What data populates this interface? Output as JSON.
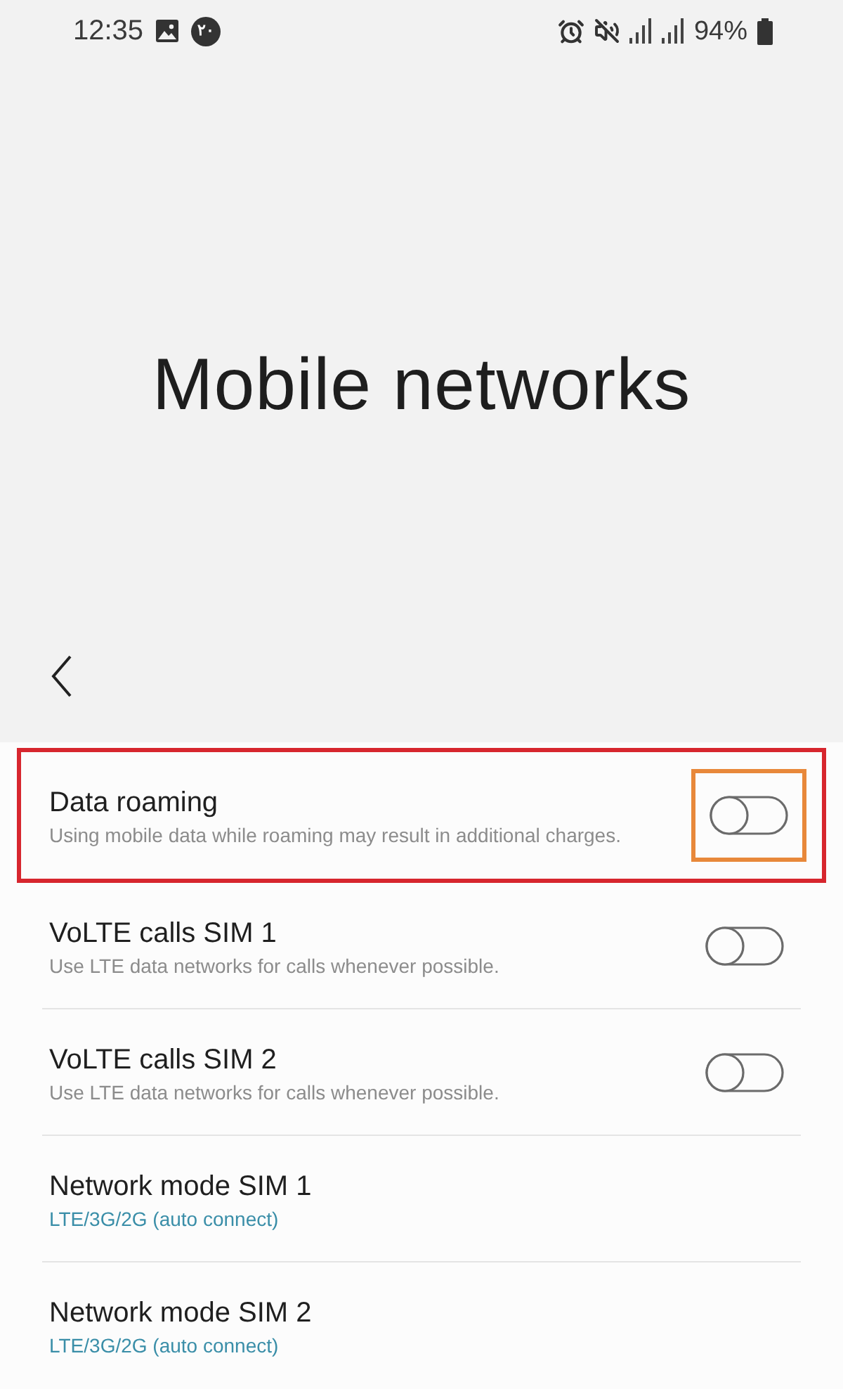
{
  "status_bar": {
    "time": "12:35",
    "notification_badge": "۲۰",
    "battery": "94%"
  },
  "header": {
    "title": "Mobile networks"
  },
  "settings": [
    {
      "kind": "toggle",
      "title": "Data roaming",
      "subtitle": "Using mobile data while roaming may result in additional charges.",
      "on": false,
      "highlighted": true,
      "toggle_highlighted": true
    },
    {
      "kind": "toggle",
      "title": "VoLTE calls SIM 1",
      "subtitle": "Use LTE data networks for calls whenever possible.",
      "on": false,
      "highlighted": false,
      "toggle_highlighted": false
    },
    {
      "kind": "toggle",
      "title": "VoLTE calls SIM 2",
      "subtitle": "Use LTE data networks for calls whenever possible.",
      "on": false,
      "highlighted": false,
      "toggle_highlighted": false
    },
    {
      "kind": "value",
      "title": "Network mode SIM 1",
      "value": "LTE/3G/2G (auto connect)",
      "highlighted": false
    },
    {
      "kind": "value",
      "title": "Network mode SIM 2",
      "value": "LTE/3G/2G (auto connect)",
      "highlighted": false
    }
  ]
}
